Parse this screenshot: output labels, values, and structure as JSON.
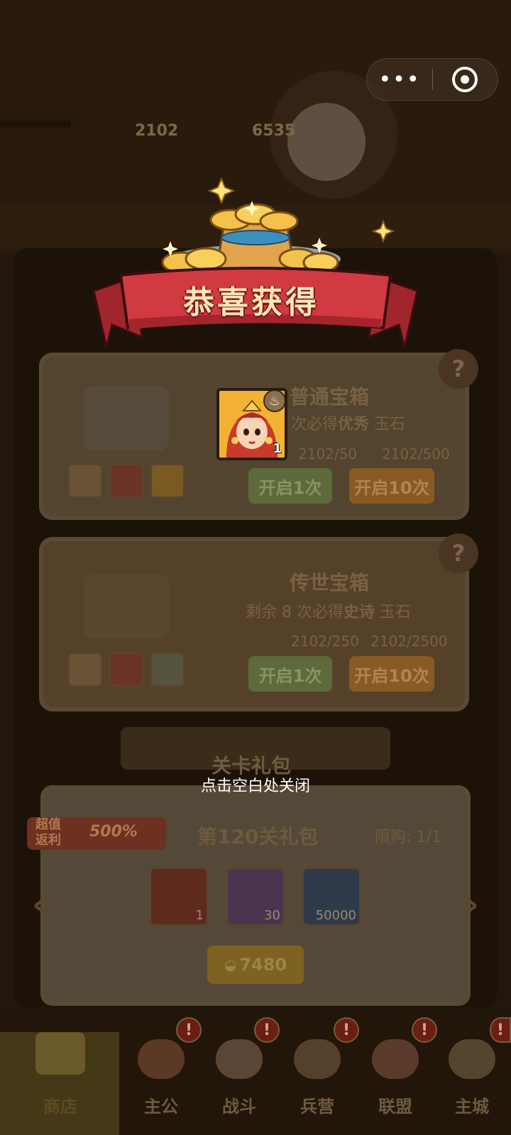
{
  "header": {
    "currency_silver": "2102",
    "currency_coin": "6535"
  },
  "modal": {
    "title": "恭喜获得",
    "reward_count": "1",
    "close_hint": "点击空白处关闭"
  },
  "chest_common": {
    "title": "普通宝箱",
    "desc_prefix": "次必得",
    "desc_quality": "优秀",
    "desc_item": "玉石",
    "cost_one": "2102/50",
    "cost_ten": "2102/500",
    "open_one": "开启1次",
    "open_ten": "开启10次",
    "help": "?"
  },
  "chest_legend": {
    "title": "传世宝箱",
    "desc": "剩余 8 次必得",
    "desc_quality": "史诗",
    "desc_item": "玉石",
    "cost_one": "2102/250",
    "cost_ten": "2102/2500",
    "open_one": "开启1次",
    "open_ten": "开启10次",
    "help": "?"
  },
  "stage_pack": {
    "section_title": "关卡礼包",
    "tag_line1": "超值",
    "tag_line2": "返利",
    "tag_percent": "500%",
    "pack_name": "第120关礼包",
    "limit": "限购: 1/1",
    "items": [
      {
        "count": "1",
        "icon": "chest-icon"
      },
      {
        "count": "30",
        "icon": "fox-icon"
      },
      {
        "count": "50000",
        "icon": "coin-icon"
      }
    ],
    "price": "7480"
  },
  "nav": {
    "tabs": [
      {
        "label": "商店",
        "icon": "shop-icon",
        "badge": ""
      },
      {
        "label": "主公",
        "icon": "lord-icon",
        "badge": "!"
      },
      {
        "label": "战斗",
        "icon": "battle-icon",
        "badge": "!"
      },
      {
        "label": "兵营",
        "icon": "barracks-icon",
        "badge": "!"
      },
      {
        "label": "联盟",
        "icon": "alliance-icon",
        "badge": "!"
      },
      {
        "label": "主城",
        "icon": "city-icon",
        "badge": "!"
      }
    ]
  },
  "colors": {
    "banner_red": "#c8343a",
    "gold": "#e8b64a",
    "hint_white": "#ffffff"
  }
}
